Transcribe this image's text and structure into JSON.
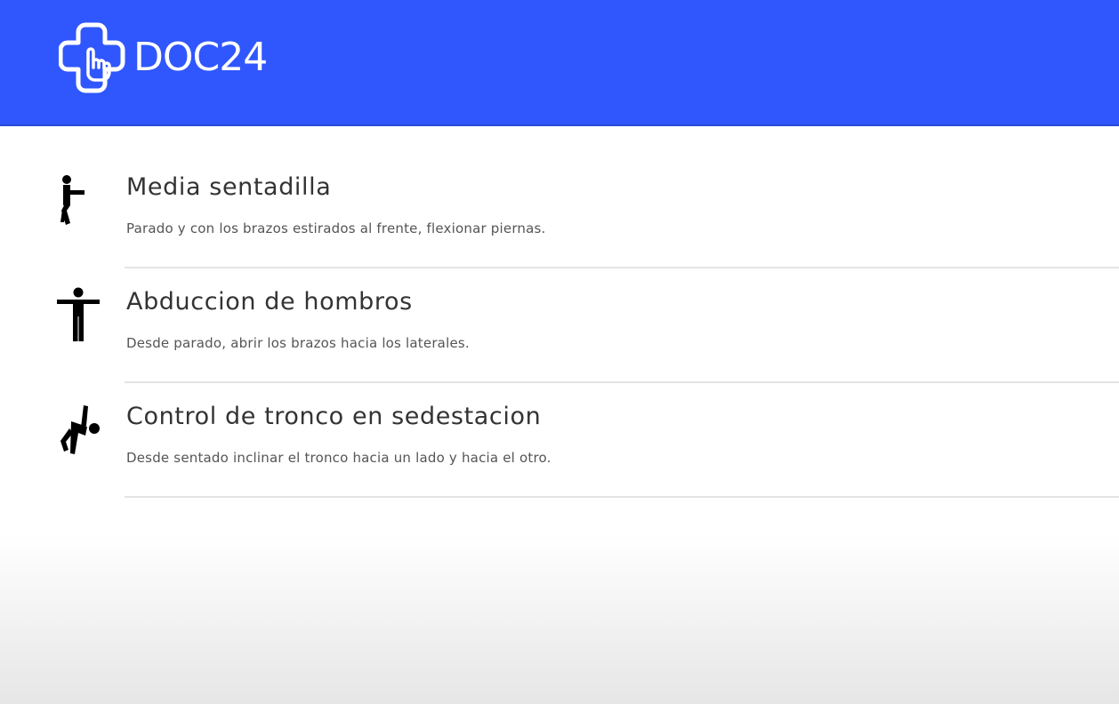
{
  "header": {
    "logo_text": "DOC24",
    "logo_icon": "cross-hand-icon",
    "background_color": "#3057fd"
  },
  "exercises": [
    {
      "title": "Media sentadilla",
      "description": "Parado y con los brazos estirados al frente, flexionar piernas.",
      "icon": "squat-figure-icon"
    },
    {
      "title": "Abduccion de hombros",
      "description": "Desde parado, abrir los brazos hacia los laterales.",
      "icon": "arms-out-figure-icon"
    },
    {
      "title": "Control de tronco en sedestacion",
      "description": "Desde sentado inclinar el tronco hacia un lado y hacia el otro.",
      "icon": "seated-side-bend-figure-icon"
    }
  ]
}
